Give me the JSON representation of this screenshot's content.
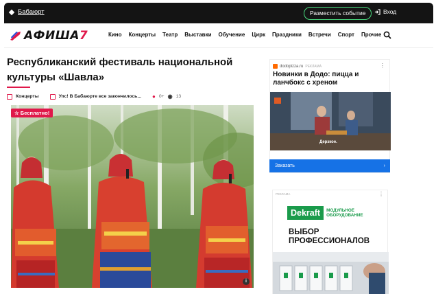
{
  "topbar": {
    "city": "Бабаюрт",
    "post_event": "Разместить событие",
    "login": "Вход"
  },
  "logo": {
    "text_main": "АФИША",
    "text_accent": "7"
  },
  "nav": [
    "Кино",
    "Концерты",
    "Театр",
    "Выставки",
    "Обучение",
    "Цирк",
    "Праздники",
    "Встречи",
    "Спорт",
    "Прочие"
  ],
  "article": {
    "title": "Республиканский фестиваль национальной культуры «Шавла»",
    "category": "Концерты",
    "venue": "Упс! В Бабаюрте все закончилось...",
    "age": "0+",
    "views": "13",
    "free_badge": "☆ Бесплатно!"
  },
  "ad1": {
    "source": "dodopizza.ru",
    "source_tag": "РЕКЛАМА",
    "headline": "Новинки в Додо: пицца и ланчбокс с хреном",
    "video_caption": "Дерзкое.",
    "cta": "Заказать"
  },
  "ad2": {
    "source_tag": "РЕКЛАМА",
    "brand": "Dekraft",
    "brand_sub_1": "МОДУЛЬНОЕ",
    "brand_sub_2": "ОБОРУДОВАНИЕ",
    "headline_1": "ВЫБОР",
    "headline_2": "ПРОФЕССИОНАЛОВ"
  },
  "colors": {
    "accent": "#e0184a",
    "green": "#1a9b4b",
    "blue": "#1672e6",
    "dark": "#141414"
  }
}
